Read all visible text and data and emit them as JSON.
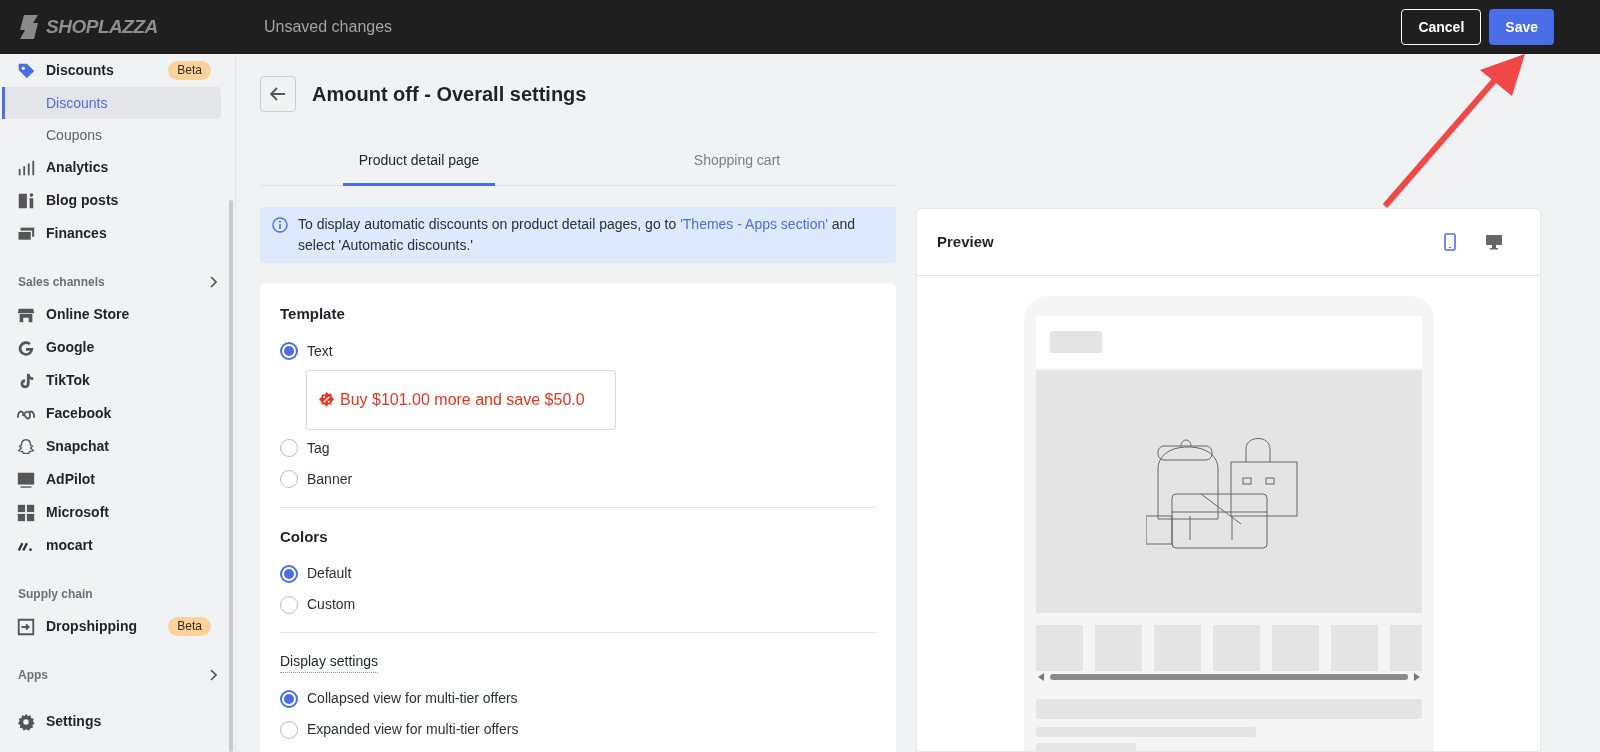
{
  "topbar": {
    "logo": "SHOPLAZZA",
    "status": "Unsaved changes",
    "buttons": [
      {
        "label": "Cancel",
        "kind": "secondary"
      },
      {
        "label": "Save",
        "kind": "primary"
      }
    ]
  },
  "sidebar": {
    "items": [
      {
        "kind": "item",
        "label": "Discounts",
        "badge": "Beta",
        "selected": false
      },
      {
        "kind": "subitem",
        "label": "Discounts",
        "selected": true
      },
      {
        "kind": "subitem",
        "label": "Coupons",
        "selected": false
      },
      {
        "kind": "item",
        "label": "Analytics",
        "selected": false
      },
      {
        "kind": "item",
        "label": "Blog posts",
        "selected": false
      },
      {
        "kind": "item",
        "label": "Finances",
        "selected": false
      },
      {
        "kind": "section",
        "label": "Sales channels",
        "chevron": true
      },
      {
        "kind": "item",
        "label": "Online Store",
        "selected": false
      },
      {
        "kind": "item",
        "label": "Google",
        "selected": false
      },
      {
        "kind": "item",
        "label": "TikTok",
        "selected": false
      },
      {
        "kind": "item",
        "label": "Facebook",
        "selected": false
      },
      {
        "kind": "item",
        "label": "Snapchat",
        "selected": false
      },
      {
        "kind": "item",
        "label": "AdPilot",
        "selected": false
      },
      {
        "kind": "item",
        "label": "Microsoft",
        "selected": false
      },
      {
        "kind": "item",
        "label": "mocart",
        "selected": false
      },
      {
        "kind": "section",
        "label": "Supply chain",
        "chevron": false
      },
      {
        "kind": "item",
        "label": "Dropshipping",
        "badge": "Beta",
        "selected": false
      },
      {
        "kind": "section",
        "label": "Apps",
        "chevron": true
      },
      {
        "kind": "item",
        "label": "Settings",
        "selected": false
      }
    ]
  },
  "page": {
    "title": "Amount off - Overall settings",
    "tabs": [
      {
        "label": "Product detail page",
        "selected": true
      },
      {
        "label": "Shopping cart",
        "selected": false
      }
    ],
    "notice": {
      "text": "To display automatic discounts on product detail pages, go to",
      "link": "'Themes - Apps section'",
      "text_after": "and select 'Automatic discounts.'"
    },
    "sections": [
      {
        "title": "Template",
        "kind": "heading",
        "options": [
          {
            "label": "Text",
            "selected": true,
            "sample": "Buy $101.00 more and save $50.0"
          },
          {
            "label": "Tag",
            "selected": false
          },
          {
            "label": "Banner",
            "selected": false
          }
        ]
      },
      {
        "title": "Colors",
        "kind": "heading",
        "options": [
          {
            "label": "Default",
            "selected": true
          },
          {
            "label": "Custom",
            "selected": false
          }
        ]
      },
      {
        "title": "Display settings",
        "kind": "tooltip",
        "options": [
          {
            "label": "Collapsed view for multi-tier offers",
            "selected": true
          },
          {
            "label": "Expanded view for multi-tier offers",
            "selected": false
          }
        ]
      }
    ]
  },
  "preview": {
    "title": "Preview",
    "views": [
      {
        "kind": "mobile",
        "selected": true
      },
      {
        "kind": "desktop",
        "selected": false
      }
    ]
  }
}
